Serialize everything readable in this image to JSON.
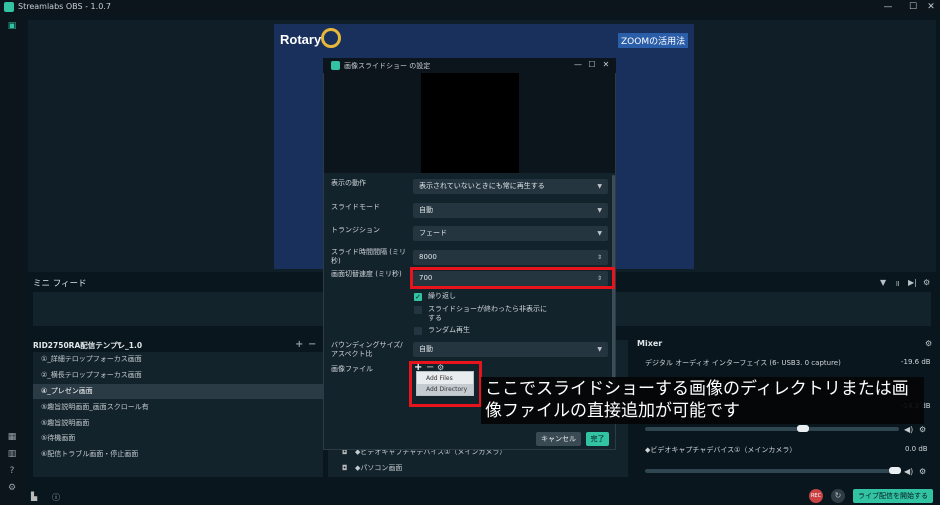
{
  "window": {
    "title": "Streamlabs OBS - 1.0.7",
    "controls": [
      "—",
      "☐",
      "✕"
    ]
  },
  "preview": {
    "brand_text": "Rotary",
    "zoom_label": "ZOOMの活用法"
  },
  "mini_feed": {
    "title": "ミニ フィード",
    "controls": [
      "▼",
      "॥",
      "▶|",
      "⚙"
    ]
  },
  "scenes": {
    "title": "RID2750RA配信テンプレ_1.0",
    "controls": [
      "+",
      "−"
    ],
    "items": [
      "①_詳細テロップフォーカス画面",
      "②_横長テロップフォーカス画面",
      "④_プレゼン画面",
      "⑤趣旨説明画面_画面スクロール有",
      "⑤趣旨説明画面",
      "⑤待機画面",
      "⑥配信トラブル画面・停止画面"
    ],
    "selected_index": 2
  },
  "sources": {
    "items": [
      "◆ビデオキャプチャデバイス①（メインカメラ）",
      "◆パソコン画面"
    ]
  },
  "mixer": {
    "title": "Mixer",
    "channels": [
      {
        "name": "デジタル オーディオ インターフェイス (6- USB3. 0 capture)",
        "db": "-19.6 dB",
        "level": 0.62
      },
      {
        "name": "",
        "db": "-14.3 dB",
        "level": 0.62
      },
      {
        "name": "◆ビデオキャプチャデバイス①（メインカメラ）",
        "db": "0.0 dB",
        "level": 0.98
      }
    ]
  },
  "footer": {
    "rec_label": "REC",
    "golive_label": "ライブ配信を開始する"
  },
  "dialog": {
    "title": "画像スライドショー の設定",
    "fields": {
      "display_behavior_label": "表示の動作",
      "display_behavior_value": "表示されていないときにも常に再生する",
      "slide_mode_label": "スライドモード",
      "slide_mode_value": "自動",
      "transition_label": "トランジション",
      "transition_value": "フェード",
      "slide_interval_label": "スライド時間間隔 (ミリ秒)",
      "slide_interval_value": "8000",
      "transition_speed_label": "画面切替速度 (ミリ秒)",
      "transition_speed_value": "700",
      "loop_label": "繰り返し",
      "hide_label": "スライドショーが終わったら非表示にする",
      "random_label": "ランダム再生",
      "bounding_label": "バウンディングサイズ/アスペクト比",
      "bounding_value": "自動",
      "image_files_label": "画像ファイル"
    },
    "checks": {
      "loop": true,
      "hide": false,
      "random": false
    },
    "file_controls": [
      "+",
      "−",
      "⚙"
    ],
    "menu_items": [
      "Add Files",
      "Add Directory"
    ],
    "cancel_label": "キャンセル",
    "done_label": "完了"
  },
  "annotation": {
    "text": "ここでスライドショーする画像のディレクトリまたは画像ファイルの直接追加が可能です"
  }
}
